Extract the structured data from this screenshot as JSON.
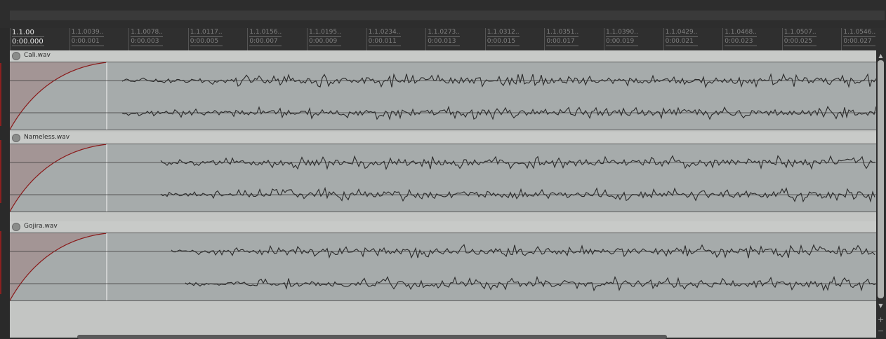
{
  "ruler": {
    "ticks": [
      {
        "beat": "1.1.00",
        "time": "0:00.000"
      },
      {
        "beat": "1.1.0039..",
        "time": "0:00.001"
      },
      {
        "beat": "1.1.0078..",
        "time": "0:00.003"
      },
      {
        "beat": "1.1.0117..",
        "time": "0:00.005"
      },
      {
        "beat": "1.1.0156..",
        "time": "0:00.007"
      },
      {
        "beat": "1.1.0195..",
        "time": "0:00.009"
      },
      {
        "beat": "1.1.0234..",
        "time": "0:00.011"
      },
      {
        "beat": "1.1.0273..",
        "time": "0:00.013"
      },
      {
        "beat": "1.1.0312..",
        "time": "0:00.015"
      },
      {
        "beat": "1.1.0351..",
        "time": "0:00.017"
      },
      {
        "beat": "1.1.0390..",
        "time": "0:00.019"
      },
      {
        "beat": "1.1.0429..",
        "time": "0:00.021"
      },
      {
        "beat": "1.1.0468..",
        "time": "0:00.023"
      },
      {
        "beat": "1.1.0507..",
        "time": "0:00.025"
      },
      {
        "beat": "1.1.0546..",
        "time": "0:00.027"
      }
    ]
  },
  "tracks": [
    {
      "name": "Cali.wav"
    },
    {
      "name": "Nameless.wav"
    },
    {
      "name": "Gojira.wav"
    }
  ],
  "icons": {
    "cursor": "edit-cursor-icon",
    "track_knob": "volume-knob-icon",
    "scroll_up": "arrow-up-icon",
    "scroll_down": "arrow-down-icon",
    "zoom_in": "plus-icon",
    "zoom_out": "minus-icon"
  },
  "colors": {
    "fade_curve": "#8a1a1a",
    "fade_fill": "#a89494",
    "item_body": "#a6abab",
    "waveform": "#2a2a2a"
  }
}
